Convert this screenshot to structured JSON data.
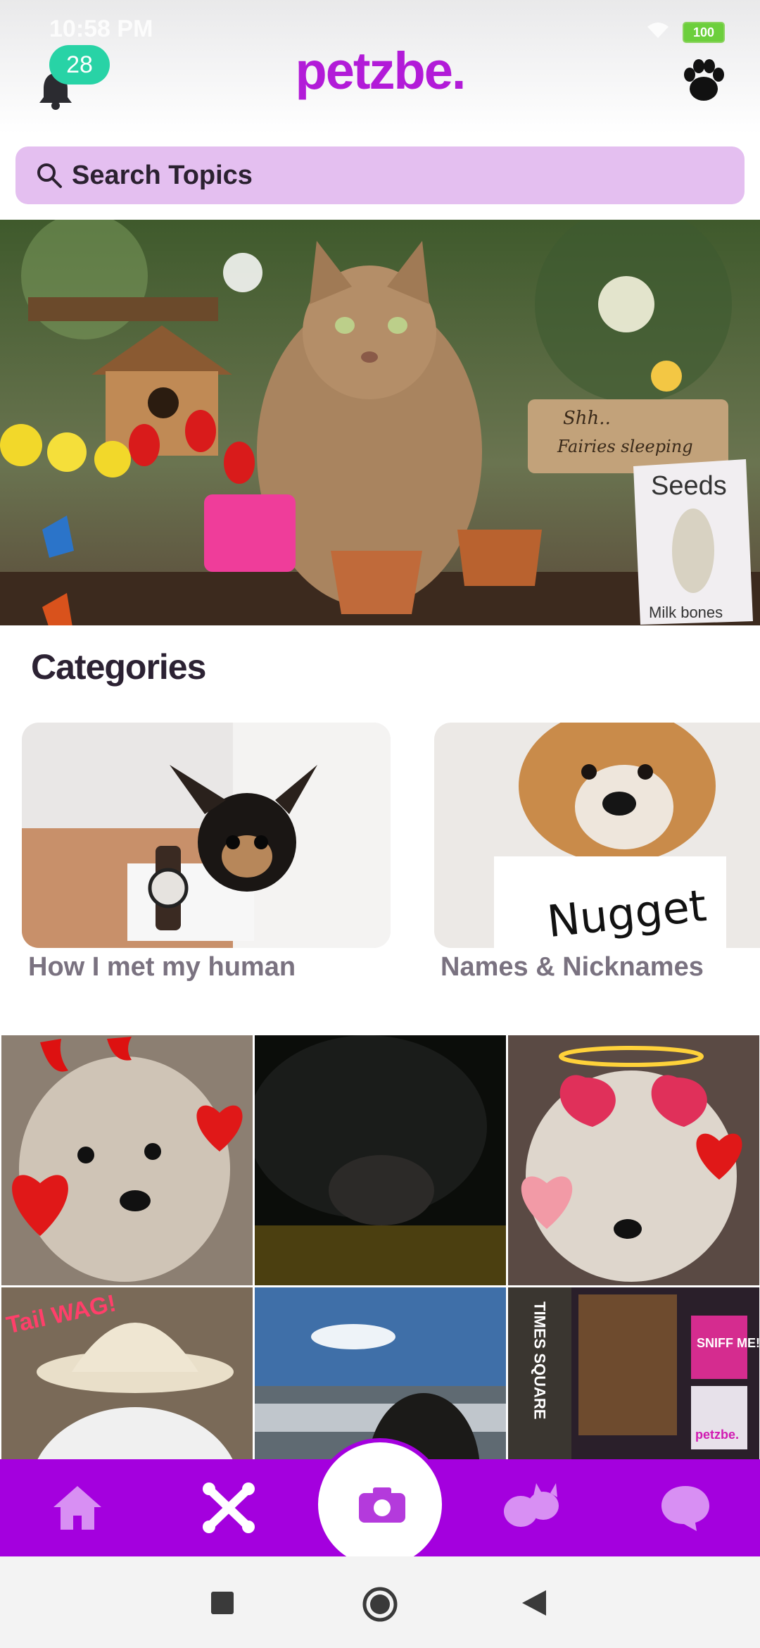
{
  "status": {
    "time": "10:58 PM",
    "battery": "100"
  },
  "header": {
    "logo": "petzbe.",
    "notification_count": "28"
  },
  "search": {
    "placeholder": "Search Topics"
  },
  "hero": {
    "sign_text": "Shh.. Fairies sleeping",
    "bag_text": "Seeds",
    "bag_sub": "Milk bones"
  },
  "categories": {
    "title": "Categories",
    "items": [
      {
        "label": "How I met my human"
      },
      {
        "label": "Names & Nicknames",
        "sign": "Nugget"
      }
    ]
  },
  "grid": {
    "tile_texts": {
      "tail": "Tail WAG!",
      "times": "TIMES SQUARE",
      "sniff": "SNIFF ME!",
      "brand": "petzbe."
    }
  },
  "nav": {
    "items": [
      "home-icon",
      "bones-icon",
      "camera-icon",
      "pets-icon",
      "chat-icon"
    ],
    "accent": "#a400de"
  },
  "colors": {
    "brand": "#b21bd8",
    "search_bg": "#e4bff0",
    "badge": "#28d3a6"
  }
}
